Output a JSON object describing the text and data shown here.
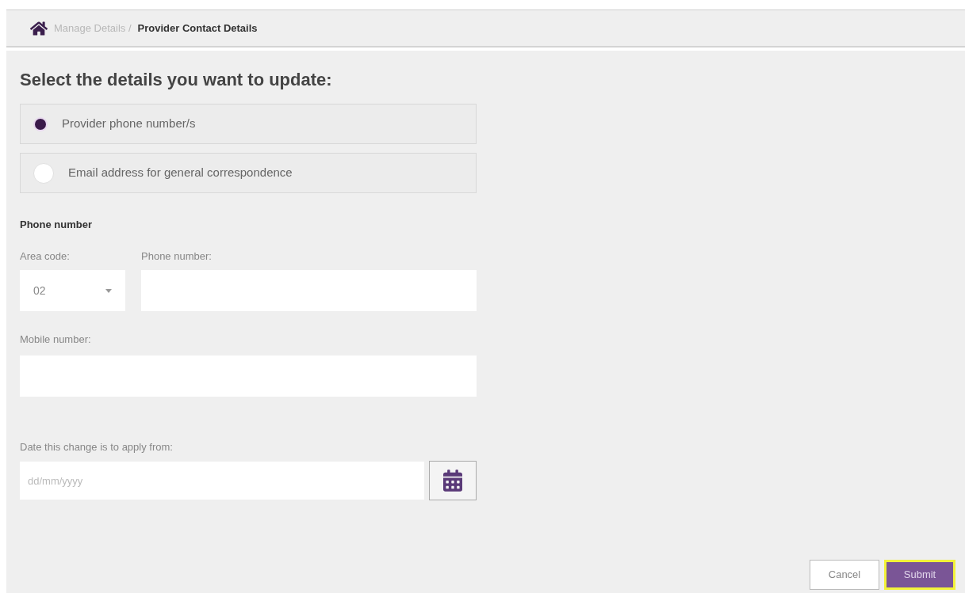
{
  "breadcrumb": {
    "parent": "Manage Details /",
    "current": "Provider Contact Details"
  },
  "heading": "Select the details you want to update:",
  "options": [
    {
      "label": "Provider phone number/s",
      "selected": true
    },
    {
      "label": "Email address for general correspondence",
      "selected": false
    }
  ],
  "section_title": "Phone number",
  "area_code": {
    "label": "Area code:",
    "value": "02"
  },
  "phone_number": {
    "label": "Phone number:"
  },
  "mobile_number": {
    "label": "Mobile number:"
  },
  "date": {
    "label": "Date this change is to apply from:",
    "placeholder": "dd/mm/yyyy"
  },
  "buttons": {
    "cancel": "Cancel",
    "submit": "Submit"
  }
}
